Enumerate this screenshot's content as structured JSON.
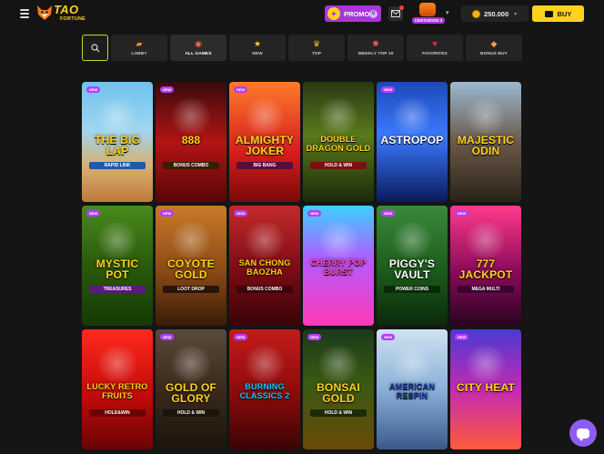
{
  "header": {
    "logo_main": "TAO",
    "logo_sub": "FORTUNE",
    "promo_label": "PROMO",
    "promo_count": "0",
    "avatar_rank": "CENTURION 3",
    "balance": "250.000",
    "buy_label": "BUY"
  },
  "categories": [
    {
      "label": "LOBBY",
      "icon": "lobby-chest-icon",
      "glyph": "▰",
      "color": "#f08a2a"
    },
    {
      "label": "ALL GAMES",
      "icon": "all-games-icon",
      "glyph": "◉",
      "color": "#ff6a3c"
    },
    {
      "label": "NEW",
      "icon": "star-icon",
      "glyph": "★",
      "color": "#ffd21c"
    },
    {
      "label": "TOP",
      "icon": "crown-icon",
      "glyph": "♛",
      "color": "#ffb21c"
    },
    {
      "label": "WEEKLY TOP 10",
      "icon": "weekly-top-icon",
      "glyph": "✺",
      "color": "#ff5a6a"
    },
    {
      "label": "FAVORITES",
      "icon": "heart-icon",
      "glyph": "♥",
      "color": "#ff2a3a"
    },
    {
      "label": "BONUS BUY",
      "icon": "money-bag-icon",
      "glyph": "◆",
      "color": "#f0a23c"
    }
  ],
  "new_badge": "NEW",
  "games": [
    {
      "title": "THE BIG LAP",
      "sub": "RAPID LINK",
      "new": true,
      "bg": "linear-gradient(180deg,#6ec3ef 0%,#9fd6ef 40%,#d8b070 70%,#c07a3a 100%)",
      "color": "#ffd21c",
      "subbg": "#1d5aa8"
    },
    {
      "title": "888",
      "sub": "BONUS COMBO",
      "new": true,
      "bg": "linear-gradient(180deg,#3a0a0a 0%,#b31414 50%,#5a0606 100%)",
      "color": "#ffd21c",
      "subbg": "#3a1d04"
    },
    {
      "title": "ALMIGHTY JOKER",
      "sub": "BIG BANG",
      "new": true,
      "bg": "linear-gradient(180deg,#ff7a2a 0%,#d41c1c 60%,#7a0a0a 100%)",
      "color": "#ffd21c",
      "subbg": "#5a0a40"
    },
    {
      "title": "DOUBLE DRAGON GOLD",
      "sub": "HOLD & WIN",
      "new": false,
      "bg": "linear-gradient(180deg,#2a3a14 0%,#5a7a1c 45%,#1a2a08 100%)",
      "color": "#ffd21c",
      "subbg": "#7a1010"
    },
    {
      "title": "ASTROPOP",
      "sub": "",
      "new": true,
      "bg": "linear-gradient(180deg,#1c4ab8 0%,#3a7aff 45%,#0a1a5a 100%)",
      "color": "#ffffff",
      "subbg": "#0a1a5a"
    },
    {
      "title": "MAJESTIC ODIN",
      "sub": "",
      "new": false,
      "bg": "linear-gradient(180deg,#9ab8d0 0%,#6a5a4a 50%,#2a2218 100%)",
      "color": "#ffd21c",
      "subbg": "#2a2218"
    },
    {
      "title": "MYSTIC POT",
      "sub": "TREASURES",
      "new": true,
      "bg": "linear-gradient(180deg,#4a8a1c 0%,#2a5a0a 50%,#143a06 100%)",
      "color": "#ffd21c",
      "subbg": "#5a1c7a"
    },
    {
      "title": "COYOTE GOLD",
      "sub": "LOOT DROP",
      "new": true,
      "bg": "linear-gradient(180deg,#c97a2a 0%,#8a4a14 55%,#3a1c08 100%)",
      "color": "#ffd21c",
      "subbg": "#2a1406"
    },
    {
      "title": "SAN CHONG BAOZHA",
      "sub": "BONUS COMBO",
      "new": true,
      "bg": "linear-gradient(180deg,#c42a2a 0%,#7a0a14 55%,#3a0408 100%)",
      "color": "#ffd21c",
      "subbg": "#3a0408"
    },
    {
      "title": "CHERRY POP BURST",
      "sub": "",
      "new": true,
      "bg": "linear-gradient(180deg,#3ad2ff 0%,#b45aff 45%,#ff3ab4 100%)",
      "color": "#ff4aa8",
      "subbg": "#5a0a5a"
    },
    {
      "title": "PIGGY'S VAULT",
      "sub": "POWER COINS",
      "new": true,
      "bg": "linear-gradient(180deg,#3a8a3a 0%,#1c5a1c 55%,#0a2a0a 100%)",
      "color": "#ffffff",
      "subbg": "#0a2a0a"
    },
    {
      "title": "777 JACKPOT",
      "sub": "MEGA MULTI",
      "new": true,
      "bg": "linear-gradient(180deg,#ff3a8a 0%,#8a0a5a 55%,#2a0420 100%)",
      "color": "#ffd21c",
      "subbg": "#3a0430"
    },
    {
      "title": "LUCKY RETRO FRUITS",
      "sub": "HOLD&WIN",
      "new": false,
      "bg": "linear-gradient(180deg,#ff2a1c 0%,#c40a0a 55%,#6a0404 100%)",
      "color": "#ffd21c",
      "subbg": "#6a0404"
    },
    {
      "title": "GOLD OF GLORY",
      "sub": "HOLD & WIN",
      "new": true,
      "bg": "linear-gradient(180deg,#5a4a3a 0%,#3a2a1c 50%,#1c140a 100%)",
      "color": "#ffd21c",
      "subbg": "#1c140a"
    },
    {
      "title": "BURNING CLASSICS 2",
      "sub": "",
      "new": true,
      "bg": "linear-gradient(180deg,#c41c1c 0%,#8a0a0a 55%,#3a0404 100%)",
      "color": "#1cc4ff",
      "subbg": "#3a0404"
    },
    {
      "title": "BONSAI GOLD",
      "sub": "HOLD & WIN",
      "new": true,
      "bg": "linear-gradient(180deg,#1a3a1a 0%,#3a5a14 45%,#6a4a08 100%)",
      "color": "#ffd21c",
      "subbg": "#1c2a08"
    },
    {
      "title": "AMERICAN RESPIN",
      "sub": "",
      "new": true,
      "bg": "linear-gradient(180deg,#cfe2f0 0%,#8ab0d8 50%,#3a5a8a 100%)",
      "color": "#1a3aa8",
      "subbg": "#c41c1c"
    },
    {
      "title": "CITY HEAT",
      "sub": "",
      "new": true,
      "bg": "linear-gradient(180deg,#4a3ad2 0%,#c42ab4 50%,#ff5a3a 100%)",
      "color": "#ffd21c",
      "subbg": "#2a0a3a"
    }
  ]
}
